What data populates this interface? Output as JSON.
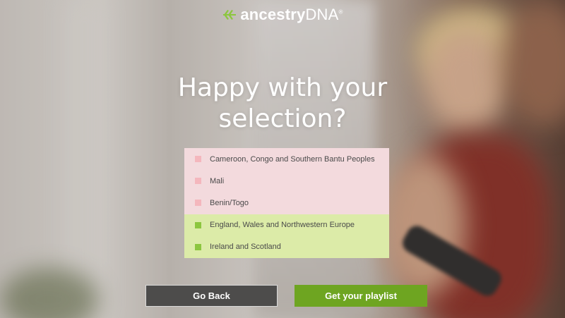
{
  "logo": {
    "brand": "ancestry",
    "product": "DNA",
    "mark": "®",
    "icon": "leaf-icon"
  },
  "heading": {
    "line1": "Happy with your",
    "line2": "selection?"
  },
  "selection": {
    "items": [
      {
        "label": "Cameroon, Congo and Southern Bantu Peoples",
        "group": "pink",
        "color": "#f4b7bd"
      },
      {
        "label": "Mali",
        "group": "pink",
        "color": "#f4b7bd"
      },
      {
        "label": "Benin/Togo",
        "group": "pink",
        "color": "#f4b7bd"
      },
      {
        "label": "England, Wales and Northwestern Europe",
        "group": "green",
        "color": "#8cc63f"
      },
      {
        "label": "Ireland and Scotland",
        "group": "green",
        "color": "#8cc63f"
      }
    ]
  },
  "buttons": {
    "back": "Go Back",
    "playlist": "Get your playlist"
  },
  "colors": {
    "accent_green": "#6ea521",
    "back_button": "#4d4c4b",
    "pink_row": "#f3dadd",
    "green_row": "#dceba8"
  }
}
